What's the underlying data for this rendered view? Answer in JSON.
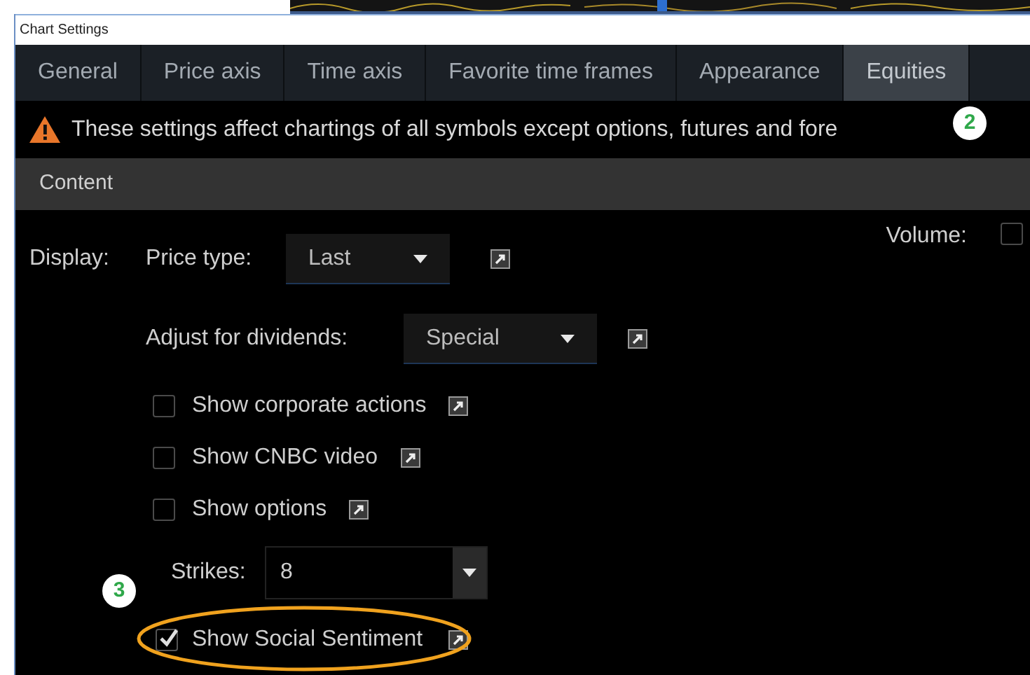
{
  "window": {
    "title": "Chart Settings"
  },
  "tabs": [
    {
      "label": "General",
      "selected": false
    },
    {
      "label": "Price axis",
      "selected": false
    },
    {
      "label": "Time axis",
      "selected": false
    },
    {
      "label": "Favorite time frames",
      "selected": false
    },
    {
      "label": "Appearance",
      "selected": false
    },
    {
      "label": "Equities",
      "selected": true
    }
  ],
  "warning": "These settings affect chartings of all symbols except options, futures and fore",
  "section": "Content",
  "display_label": "Display:",
  "price_type": {
    "label": "Price type:",
    "value": "Last"
  },
  "volume": {
    "label": "Volume:",
    "checked": false
  },
  "dividends": {
    "label": "Adjust for dividends:",
    "value": "Special"
  },
  "options": [
    {
      "label": "Show corporate actions",
      "checked": false
    },
    {
      "label": "Show CNBC video",
      "checked": false
    },
    {
      "label": "Show options",
      "checked": false
    }
  ],
  "strikes": {
    "label": "Strikes:",
    "value": "8"
  },
  "social": {
    "label": "Show Social Sentiment",
    "checked": true,
    "highlighted": true
  },
  "callouts": [
    {
      "number": "2"
    },
    {
      "number": "3"
    }
  ]
}
